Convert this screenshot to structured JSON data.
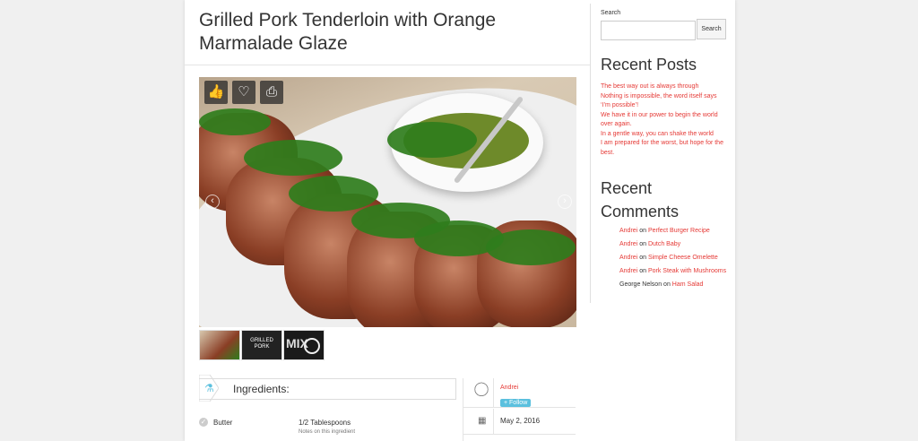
{
  "recipe": {
    "title": "Grilled Pork Tenderloin with Orange Marmalade Glaze"
  },
  "gallery": {
    "actions": [
      {
        "name": "like",
        "icon": "thumbs-up-icon"
      },
      {
        "name": "favorite",
        "icon": "heart-icon"
      },
      {
        "name": "print",
        "icon": "print-icon"
      }
    ],
    "thumbs": [
      {
        "name": "thumb-1"
      },
      {
        "name": "thumb-2",
        "caption": "GRILLED PORK"
      },
      {
        "name": "thumb-3",
        "caption": "MIX"
      }
    ]
  },
  "ingredients": {
    "label": "Ingredients:",
    "items": [
      {
        "name": "Butter",
        "amount": "1/2 Tablespoons",
        "note": "Notes on this ingredient"
      }
    ]
  },
  "author": {
    "name": "Andrei",
    "follow_label": "+ Follow",
    "date": "May 2, 2016"
  },
  "sidebar": {
    "search_label": "Search",
    "search_button": "Search",
    "recent_posts_title": "Recent Posts",
    "recent_posts": [
      "The best way out is always through",
      "Nothing is impossible, the word itself says ‘I’m possible’!",
      "We have it in our power to begin the world over again.",
      "In a gentle way, you can shake the world",
      "I am prepared for the worst, but hope for the best."
    ],
    "recent_comments_title_line1": "Recent",
    "recent_comments_title_line2": "Comments",
    "recent_comments": [
      {
        "author": "Andrei",
        "on": "on",
        "post": "Perfect Burger Recipe"
      },
      {
        "author": "Andrei",
        "on": "on",
        "post": "Dutch Baby"
      },
      {
        "author": "Andrei",
        "on": "on",
        "post": "Simple Cheese Omelette"
      },
      {
        "author": "Andrei",
        "on": "on",
        "post": "Pork Steak with Mushrooms"
      },
      {
        "author": "George Nelson",
        "on": "on",
        "post": "Ham Salad"
      }
    ]
  }
}
